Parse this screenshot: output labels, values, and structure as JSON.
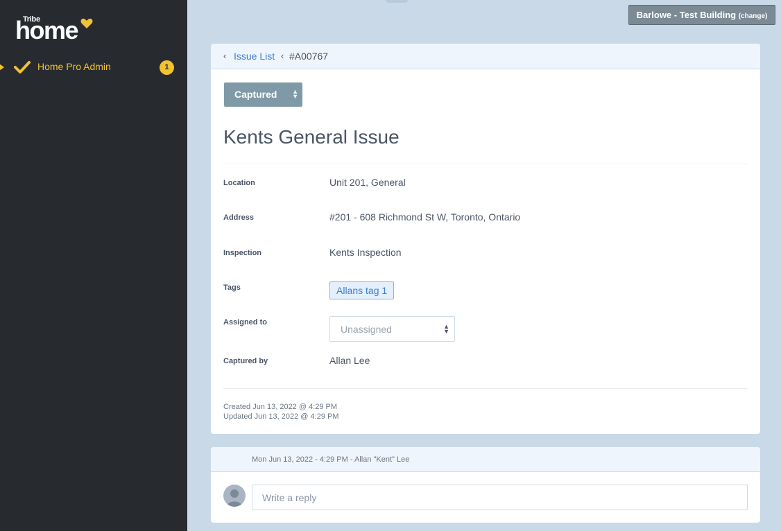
{
  "sidebar": {
    "logo_small": "Tribe",
    "logo_main": "home",
    "items": [
      {
        "label": "Home Pro Admin",
        "badge": "1"
      }
    ]
  },
  "header": {
    "building_name": "Barlowe - Test Building",
    "building_change": "(change)"
  },
  "breadcrumb": {
    "back_link": "Issue List",
    "current": "#A00767"
  },
  "issue": {
    "status": "Captured",
    "title": "Kents General Issue",
    "fields": {
      "location_label": "Location",
      "location_value": "Unit 201, General",
      "address_label": "Address",
      "address_value": "#201 - 608 Richmond St W, Toronto, Ontario",
      "inspection_label": "Inspection",
      "inspection_value": "Kents Inspection",
      "tags_label": "Tags",
      "tags": [
        "Allans tag 1"
      ],
      "assigned_label": "Assigned to",
      "assigned_value": "Unassigned",
      "captured_label": "Captured by",
      "captured_value": "Allan Lee"
    },
    "created": "Created Jun 13, 2022 @ 4:29 PM",
    "updated": "Updated Jun 13, 2022 @ 4:29 PM"
  },
  "comment": {
    "meta": "Mon Jun 13, 2022 - 4:29 PM - Allan \"Kent\" Lee",
    "reply_placeholder": "Write a reply"
  },
  "colors": {
    "sidebar_bg": "#272b30",
    "accent_yellow": "#f2c230",
    "page_bg": "#c9d9e8",
    "link_blue": "#3d7fd1",
    "status_bg": "#7f9aa6"
  }
}
